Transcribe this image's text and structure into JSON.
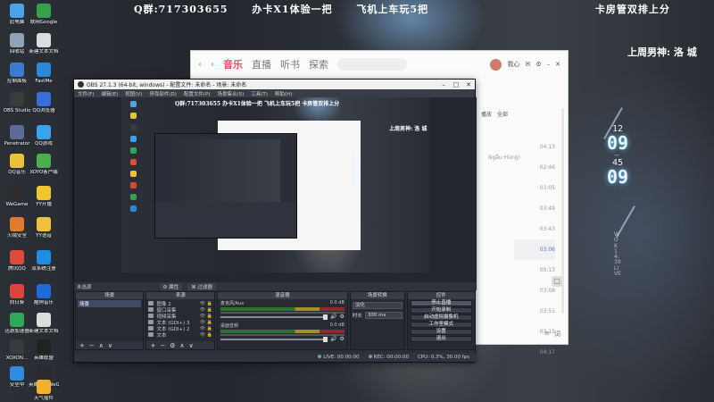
{
  "desktop": {
    "banner": [
      "Q群:717303655",
      "办卡X1体验一把",
      "飞机上车玩5把",
      "卡房管双排上分"
    ],
    "right_note": "上周男神: 洛 城",
    "clock": {
      "month": "12",
      "day": "09",
      "hour": "45",
      "minute": "09"
    },
    "vertical_note": "WOK 14:39 LIVE",
    "icons": [
      {
        "label": "此电脑",
        "color": "#4da3e8"
      },
      {
        "label": "回收站",
        "color": "#8fa3b8"
      },
      {
        "label": "控制面板",
        "color": "#3d7bd0"
      },
      {
        "label": "OBS Studio",
        "color": "#3b3b3b"
      },
      {
        "label": "Penetrator",
        "color": "#5a6a9a"
      },
      {
        "label": "QQ音乐",
        "color": "#e8c33a"
      },
      {
        "label": "WeGame",
        "color": "#2d2d2d"
      },
      {
        "label": "火绒安全",
        "color": "#e07b2a"
      },
      {
        "label": "腾讯QQ",
        "color": "#e04a3a"
      },
      {
        "label": "向日葵",
        "color": "#d9473c"
      },
      {
        "label": "迅游加速器",
        "color": "#2fa85a"
      },
      {
        "label": "XOXON...",
        "color": "#3a3a3a"
      },
      {
        "label": "安全中",
        "color": "#2e8be0"
      },
      {
        "label": "联网Google",
        "color": "#36a04a"
      },
      {
        "label": "新建文本文档",
        "color": "#ddd"
      },
      {
        "label": "FastMe",
        "color": "#2a88d8"
      },
      {
        "label": "QQ浏览器",
        "color": "#3a6fd8"
      },
      {
        "label": "QQ游戏",
        "color": "#3aa3f0"
      },
      {
        "label": "XOYO客户端",
        "color": "#4bb04b"
      },
      {
        "label": "YY开播",
        "color": "#f2c530"
      },
      {
        "label": "YY语音",
        "color": "#f0c13a"
      },
      {
        "label": "双系统注册",
        "color": "#1d8fe0"
      },
      {
        "label": "酷狗音乐",
        "color": "#1e6ad8"
      },
      {
        "label": "新建文本文档",
        "color": "#ddd"
      },
      {
        "label": "英雄联盟",
        "color": "#222"
      },
      {
        "label": "英雄联盟WeGame版",
        "color": "#2a2a2a"
      },
      {
        "label": "天气插件",
        "color": "#f2b22e"
      }
    ]
  },
  "music": {
    "tabs": [
      "音乐",
      "直播",
      "听书",
      "探索"
    ],
    "user": "我心",
    "panel_labels": [
      "播放",
      "全部"
    ],
    "durations": [
      "04:13",
      "02:46",
      "03:05",
      "03:49",
      "03:43",
      "03:06",
      "05:13",
      "03:08",
      "03:51",
      "03:15",
      "04:17"
    ],
    "hint": "Ngẫu Hùng)"
  },
  "obs": {
    "title": "OBS 27.1.3 (64-bit, windows) - 配置文件: 未命名 - 场景: 未命名",
    "menu": [
      "文件(F)",
      "编辑(E)",
      "视图(V)",
      "停靠部件(D)",
      "配置文件(P)",
      "场景集合(S)",
      "工具(T)",
      "帮助(H)"
    ],
    "preview_text": "Q群:717303655   办卡X1体验一把   飞机上车玩5把   卡房管双排上分",
    "preview_right": "上周男神: 洛 城",
    "no_source": "未选源",
    "tab_buttons": [
      "属性",
      "过滤器"
    ],
    "docks": {
      "scenes": {
        "title": "场景",
        "items": [
          "场景"
        ]
      },
      "sources": {
        "title": "来源",
        "items": [
          "图像 2",
          "窗口采集",
          "视频采集",
          "文本 (GDI+) 3",
          "文本 (GDI+) 2",
          "文本"
        ]
      },
      "mixer": {
        "title": "混音器",
        "channels": [
          {
            "name": "麦克风/Aux",
            "db": "0.0 dB"
          },
          {
            "name": "桌面音频",
            "db": "0.0 dB"
          }
        ]
      },
      "transitions": {
        "title": "场景转换",
        "type": "淡化",
        "duration_label": "时长",
        "duration": "300 ms"
      },
      "controls": {
        "title": "控件",
        "buttons": [
          "停止直播",
          "开始录制",
          "启动虚拟摄像机",
          "工作室模式",
          "设置",
          "退出"
        ]
      }
    },
    "status": {
      "live": "LIVE: 00:00:00",
      "rec": "REC: 00:00:00",
      "cpu": "CPU: 0.3%, 30.00 fps"
    }
  }
}
